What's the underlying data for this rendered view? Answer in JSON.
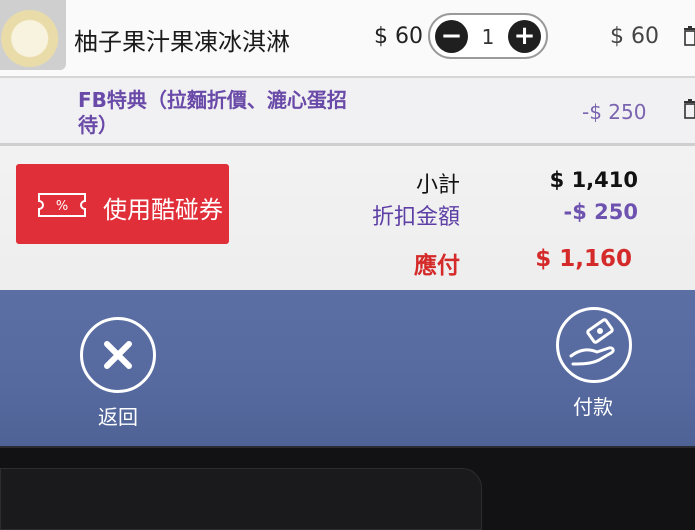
{
  "item": {
    "name": "柚子果汁果凍冰淇淋",
    "unit_price": "$ 60",
    "quantity": "1",
    "line_total": "$ 60"
  },
  "discount_item": {
    "name": "FB特典（拉麵折價、漉心蛋招待）",
    "amount": "-$ 250"
  },
  "coupon_button": {
    "label": "使用酷碰券",
    "icon": "coupon-ticket-icon"
  },
  "summary": {
    "subtotal_label": "小計",
    "subtotal_value": "$ 1,410",
    "discount_label": "折扣金額",
    "discount_value": "-$ 250",
    "due_label": "應付",
    "due_value": "$ 1,160"
  },
  "actions": {
    "back_label": "返回",
    "pay_label": "付款"
  },
  "colors": {
    "coupon_red": "#e12f3a",
    "discount_purple": "#6a4aa8",
    "due_red": "#d52a2a",
    "panel_blue": "#5b6fa4"
  }
}
